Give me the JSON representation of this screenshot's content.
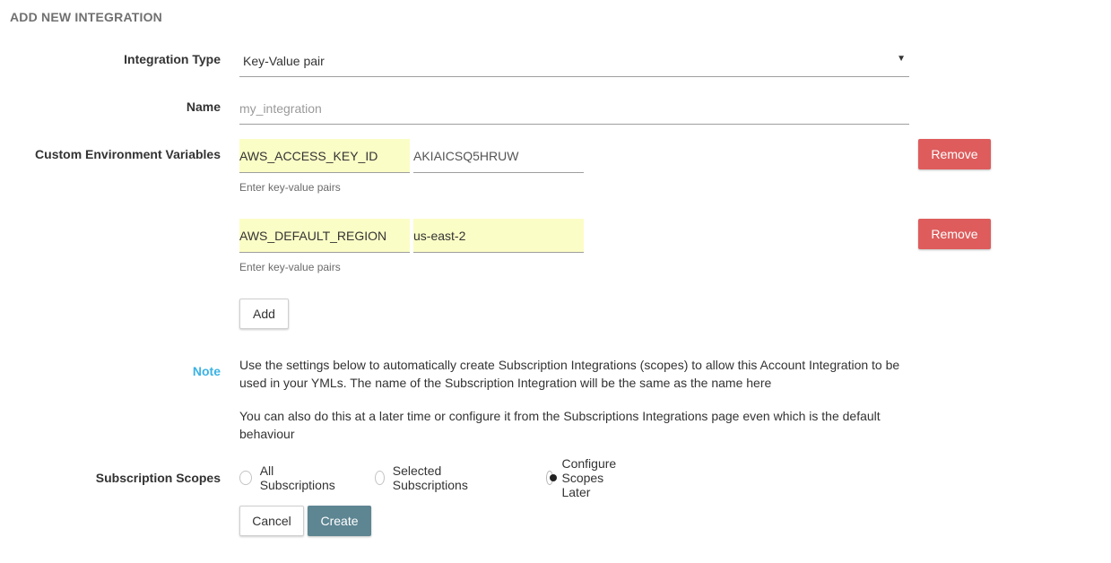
{
  "page": {
    "title": "ADD NEW INTEGRATION"
  },
  "form": {
    "integration_type": {
      "label": "Integration Type",
      "value": "Key-Value pair",
      "arrow_icon": "caret-down-icon"
    },
    "name": {
      "label": "Name",
      "value": "",
      "placeholder": "my_integration"
    },
    "env_vars": {
      "label": "Custom Environment Variables",
      "hint": "Enter key-value pairs",
      "rows": [
        {
          "key": "AWS_ACCESS_KEY_ID",
          "value": "AKIAICSQ5HRUW",
          "remove_label": "Remove"
        },
        {
          "key": "AWS_DEFAULT_REGION",
          "value": "us-east-2",
          "remove_label": "Remove"
        }
      ],
      "add_label": "Add"
    },
    "note": {
      "label": "Note",
      "paragraph_1": "Use the settings below to automatically create Subscription Integrations (scopes) to allow this Account Integration to be used in your YMLs. The name of the Subscription Integration will be the same as the name here",
      "paragraph_2": "You can also do this at a later time or configure it from the Subscriptions Integrations page even which is the default behaviour"
    },
    "subscription_scopes": {
      "label": "Subscription Scopes",
      "options": [
        {
          "label": "All Subscriptions",
          "checked": false
        },
        {
          "label": "Selected Subscriptions",
          "checked": false
        },
        {
          "label": "Configure Scopes Later",
          "checked": true
        }
      ]
    },
    "actions": {
      "cancel_label": "Cancel",
      "create_label": "Create"
    }
  },
  "colors": {
    "remove_button": "#de5c5c",
    "create_button": "#5d8592",
    "note_label": "#3bb3e4",
    "highlight_field": "#fbfdc6"
  }
}
